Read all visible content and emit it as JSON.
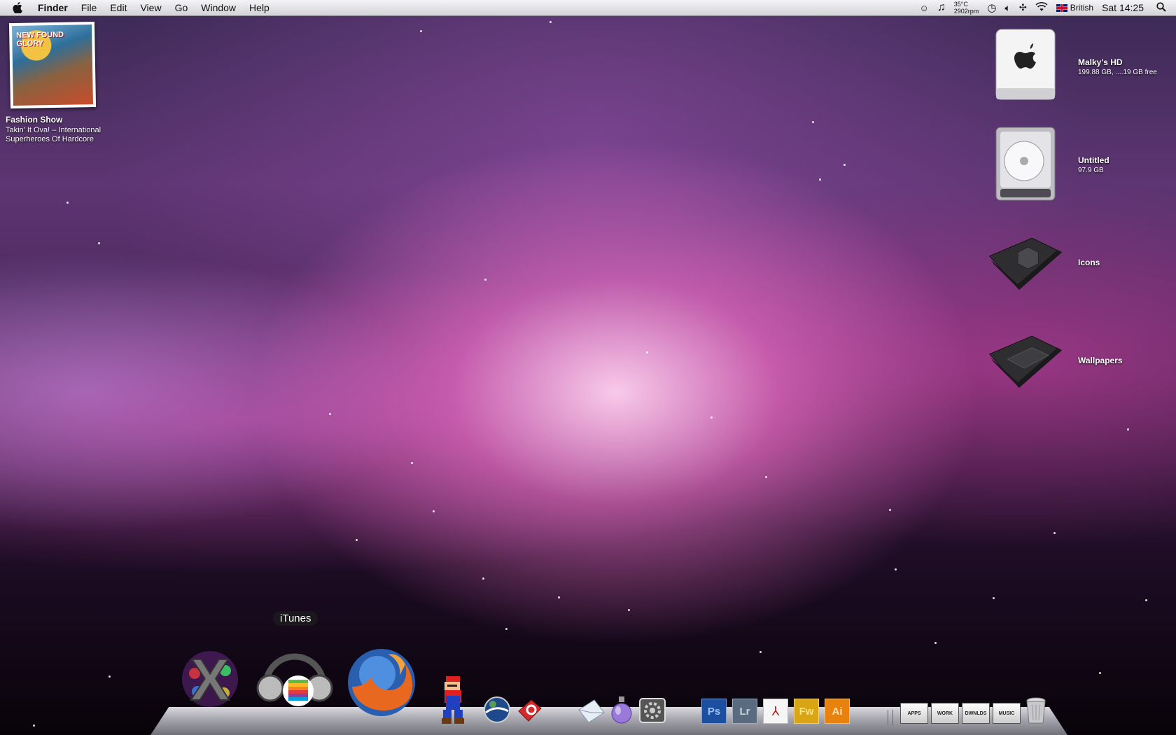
{
  "menubar": {
    "app_name": "Finder",
    "menus": [
      "File",
      "Edit",
      "View",
      "Go",
      "Window",
      "Help"
    ],
    "temperature": "35°C",
    "fan_speed": "2902rpm",
    "input_source": "British",
    "clock": "Sat 14:25"
  },
  "now_playing": {
    "song": "Fashion Show",
    "artist_line1": "Takin' It Ova! – International",
    "artist_line2": "Superheroes Of Hardcore",
    "album_text": "NEW FOUND GLORY"
  },
  "desktop_icons": [
    {
      "label": "Malky's HD",
      "sub": "199.88 GB, ....19 GB free"
    },
    {
      "label": "Untitled",
      "sub": "97.9 GB"
    },
    {
      "label": "Icons",
      "sub": ""
    },
    {
      "label": "Wallpapers",
      "sub": ""
    }
  ],
  "dock": {
    "tooltip": "iTunes",
    "stacks": [
      {
        "label": "APPS"
      },
      {
        "label": "WORK"
      },
      {
        "label": "DWNLDS"
      },
      {
        "label": "MUSIC"
      }
    ],
    "adobe_labels": [
      "Ps",
      "Lr",
      "",
      "Fw",
      "Ai"
    ]
  },
  "colors": {
    "ps": "#1d4fa0",
    "lr": "#5a6b7f",
    "fw": "#d9a514",
    "ai": "#e8820c",
    "firefox_orange": "#e8681f",
    "firefox_blue": "#2a5fb0"
  }
}
